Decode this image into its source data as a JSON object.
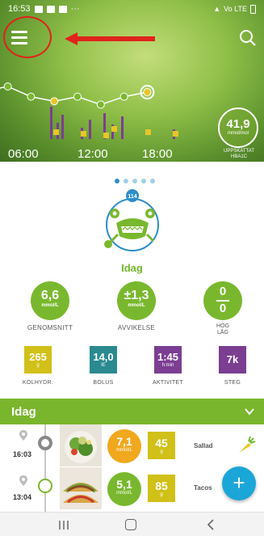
{
  "status_bar": {
    "time": "16:53",
    "right_text": "Vo LTE"
  },
  "header": {
    "menu_icon": "hamburger-menu-icon",
    "search_icon": "search-icon",
    "annotation": {
      "circle_color": "#e0231c",
      "arrow_color": "#e0231c"
    }
  },
  "chart_data": {
    "type": "line",
    "x_ticks": [
      "06:00",
      "12:00",
      "18:00"
    ],
    "glucose_points": [
      {
        "x": "04:00",
        "y": 6.3
      },
      {
        "x": "05:00",
        "y": 6.5
      },
      {
        "x": "07:00",
        "y": 5.6
      },
      {
        "x": "09:00",
        "y": 5.2
      },
      {
        "x": "11:00",
        "y": 5.6
      },
      {
        "x": "13:00",
        "y": 4.9
      },
      {
        "x": "15:00",
        "y": 5.6
      },
      {
        "x": "17:00",
        "y": 6.0
      }
    ],
    "line_color": "#ffffff",
    "point_colors": [
      "#e8c628",
      "#79b82e",
      "#79b82e",
      "#e8c628",
      "#79b82e",
      "#79b82e",
      "#79b82e",
      "#e8c628"
    ],
    "insulin_bar_color": "#7b3e92",
    "carb_marker_color": "#e8c628"
  },
  "hba1c": {
    "value": "41,9",
    "unit": "mmol/mol",
    "caption": "UPPSKATTAT HBA1C"
  },
  "carousel": {
    "count": 5,
    "active": 0
  },
  "mascot": {
    "badge": "114"
  },
  "today_title": "Idag",
  "stats": {
    "average": {
      "value": "6,6",
      "unit": "mmol/L",
      "label": "GENOMSNITT"
    },
    "deviation": {
      "value": "±1,3",
      "unit": "mmol/L",
      "label": "AVVIKELSE"
    },
    "high_low": {
      "high": "0",
      "low": "0",
      "label_high": "HÖG",
      "label_low": "LÅG"
    }
  },
  "tiles": [
    {
      "value": "265",
      "unit": "g",
      "label": "KOLHYDR.",
      "color": "#d1c018"
    },
    {
      "value": "14,0",
      "unit": "IE",
      "label": "BOLUS",
      "color": "#2a8a8f"
    },
    {
      "value": "1:45",
      "unit": "h:min",
      "label": "AKTIVITET",
      "color": "#7b3e92"
    },
    {
      "value": "7k",
      "unit": "",
      "label": "STEG",
      "color": "#7b3e92"
    }
  ],
  "list": {
    "title": "Idag",
    "entries": [
      {
        "time": "16:03",
        "glucose": "7,1",
        "glucose_unit": "mmol/L",
        "glucose_color": "#f0a81e",
        "carbs": "45",
        "carbs_unit": "g",
        "meal": "Sallad"
      },
      {
        "time": "13:04",
        "glucose": "5,1",
        "glucose_unit": "mmol/L",
        "glucose_color": "#79b82e",
        "carbs": "85",
        "carbs_unit": "g",
        "meal": "Tacos"
      }
    ]
  },
  "fab_label": "+",
  "colors": {
    "accent_green": "#7ab52e",
    "fab_blue": "#1ba6d8"
  }
}
